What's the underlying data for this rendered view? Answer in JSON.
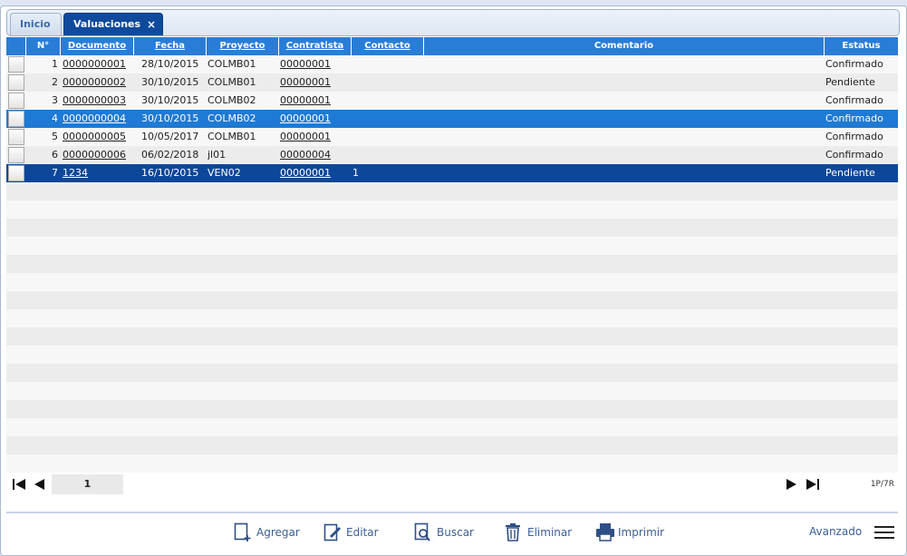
{
  "tabs": [
    {
      "label": "Inicio"
    },
    {
      "label": "Valuaciones",
      "close_icon": "×"
    }
  ],
  "grid": {
    "columns": [
      "N°",
      "Documento",
      "Fecha",
      "Proyecto",
      "Contratista",
      "Contacto",
      "Comentario",
      "Estatus"
    ],
    "rows": [
      {
        "n": "1",
        "documento": "0000000001",
        "fecha": "28/10/2015",
        "proyecto": "COLMB01",
        "contratista": "00000001",
        "contacto": "",
        "comentario": "",
        "estatus": "Confirmado"
      },
      {
        "n": "2",
        "documento": "0000000002",
        "fecha": "30/10/2015",
        "proyecto": "COLMB01",
        "contratista": "00000001",
        "contacto": "",
        "comentario": "",
        "estatus": "Pendiente"
      },
      {
        "n": "3",
        "documento": "0000000003",
        "fecha": "30/10/2015",
        "proyecto": "COLMB02",
        "contratista": "00000001",
        "contacto": "",
        "comentario": "",
        "estatus": "Confirmado"
      },
      {
        "n": "4",
        "documento": "0000000004",
        "fecha": "30/10/2015",
        "proyecto": "COLMB02",
        "contratista": "00000001",
        "contacto": "",
        "comentario": "",
        "estatus": "Confirmado"
      },
      {
        "n": "5",
        "documento": "0000000005",
        "fecha": "10/05/2017",
        "proyecto": "COLMB01",
        "contratista": "00000001",
        "contacto": "",
        "comentario": "",
        "estatus": "Confirmado"
      },
      {
        "n": "6",
        "documento": "0000000006",
        "fecha": "06/02/2018",
        "proyecto": "jl01",
        "contratista": "00000004",
        "contacto": "",
        "comentario": "",
        "estatus": "Confirmado"
      },
      {
        "n": "7",
        "documento": "1234",
        "fecha": "16/10/2015",
        "proyecto": "VEN02",
        "contratista": "00000001",
        "contacto": "1",
        "comentario": "",
        "estatus": "Pendiente"
      }
    ]
  },
  "pager": {
    "page": "1",
    "info": "1P/7R"
  },
  "toolbar": {
    "agregar": "Agregar",
    "editar": "Editar",
    "buscar": "Buscar",
    "eliminar": "Eliminar",
    "imprimir": "Imprimir",
    "avanzado": "Avanzado"
  },
  "colors": {
    "header": "#2a7dd6",
    "selected": "#1e7ad4",
    "selected_dark": "#0d4799",
    "tab_active": "#0f4a9c"
  }
}
